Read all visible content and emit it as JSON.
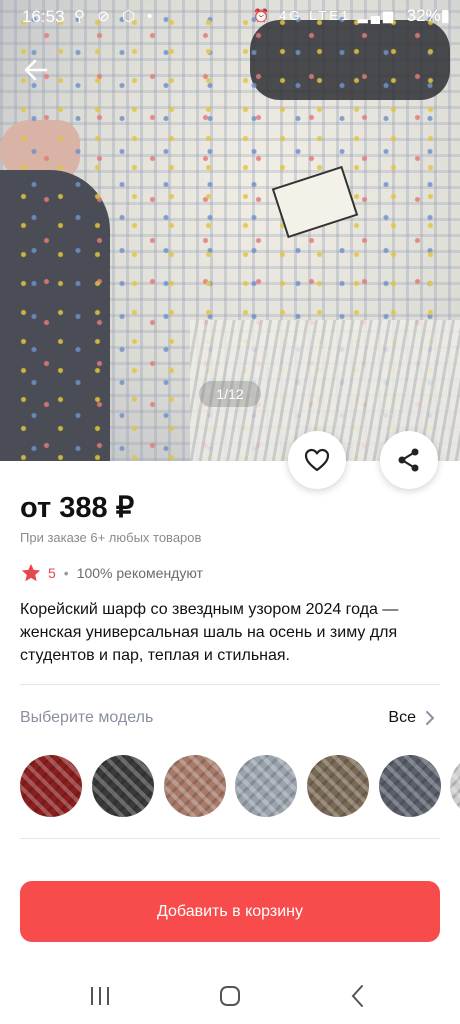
{
  "status_bar": {
    "time": "16:53",
    "battery": "32%",
    "network": "4G LTE1"
  },
  "gallery": {
    "counter": "1/12"
  },
  "product": {
    "price": "от 388 ₽",
    "price_note": "При заказе 6+ любых товаров",
    "rating": "5",
    "separator": "•",
    "recommend": "100% рекомендуют",
    "description": "Корейский шарф со звездным узором 2024 года — женская универсальная шаль на осень и зиму для студентов и пар, теплая и стильная."
  },
  "variants": {
    "title": "Выберите модель",
    "all_label": "Все",
    "items": [
      {
        "color": "#8b1f1f"
      },
      {
        "color": "#3a3a3a"
      },
      {
        "color": "#a87a6a"
      },
      {
        "color": "#9aa3ad"
      },
      {
        "color": "#7a6a55"
      },
      {
        "color": "#5a5f6b"
      },
      {
        "color": "#cfcfcf"
      }
    ]
  },
  "actions": {
    "add_to_cart": "Добавить в корзину"
  },
  "colors": {
    "accent": "#f84c4c",
    "star": "#e8464f"
  }
}
